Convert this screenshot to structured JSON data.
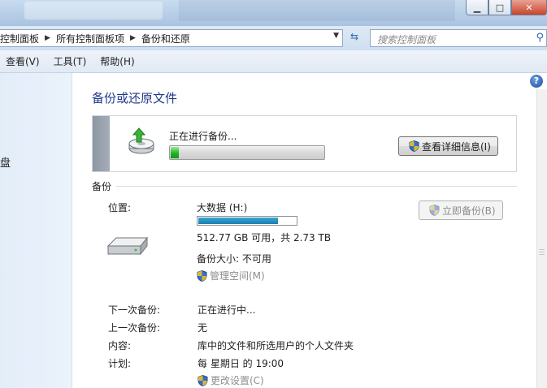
{
  "window": {
    "minimize_glyph": "▁",
    "maximize_glyph": "□",
    "close_glyph": "✕"
  },
  "address": {
    "crumbs": [
      "控制面板",
      "所有控制面板项",
      "备份和还原"
    ],
    "search_placeholder": "搜索控制面板"
  },
  "menu": [
    "查看(V)",
    "工具(T)",
    "帮助(H)"
  ],
  "left_pane": {
    "partial_text": "盘"
  },
  "main": {
    "title": "备份或还原文件",
    "progress": {
      "status": "正在进行备份...",
      "fraction": 0.05,
      "details_button": "查看详细信息(I)"
    },
    "backup_section": "备份",
    "location_label": "位置:",
    "drive_name": "大数据 (H:)",
    "drive_usage_fraction": 0.82,
    "drive_space": "512.77 GB 可用，共 2.73 TB",
    "backup_size": "备份大小: 不可用",
    "manage_space": "管理空间(M)",
    "backup_now": "立即备份(B)",
    "details": [
      {
        "label": "下一次备份:",
        "value": "正在进行中..."
      },
      {
        "label": "上一次备份:",
        "value": "无"
      },
      {
        "label": "内容:",
        "value": "库中的文件和所选用户的个人文件夹"
      },
      {
        "label": "计划:",
        "value": "每 星期日 的 19:00"
      }
    ],
    "change_settings": "更改设置(C)"
  },
  "help_glyph": "?",
  "colors": {
    "title_blue": "#1e3a8a",
    "progress_green": "#22b422",
    "drive_bar": "#1a7fb0"
  }
}
